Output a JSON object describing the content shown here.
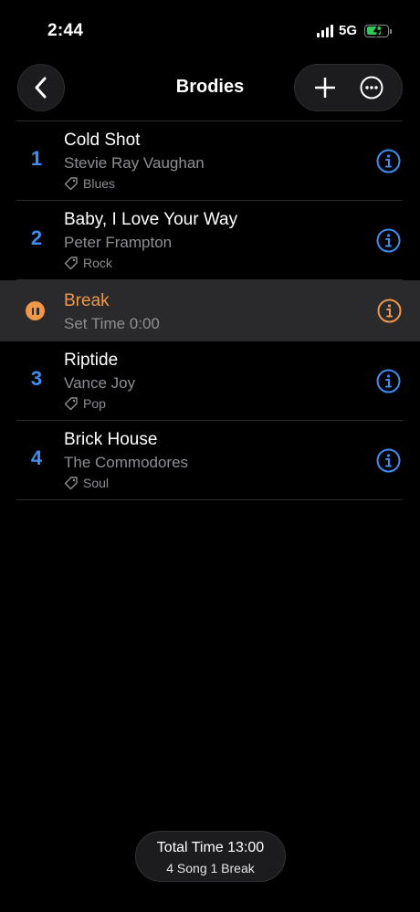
{
  "status_bar": {
    "time": "2:44",
    "network": "5G"
  },
  "nav": {
    "title": "Brodies",
    "back_icon": "chevron-left-icon",
    "add_icon": "plus-icon",
    "more_icon": "ellipsis-circle-icon"
  },
  "items": [
    {
      "type": "song",
      "number": "1",
      "title": "Cold Shot",
      "artist": "Stevie Ray Vaughan",
      "tag": "Blues"
    },
    {
      "type": "song",
      "number": "2",
      "title": "Baby, I Love Your Way",
      "artist": "Peter Frampton",
      "tag": "Rock"
    },
    {
      "type": "break",
      "title": "Break",
      "subtitle": "Set Time 0:00"
    },
    {
      "type": "song",
      "number": "3",
      "title": "Riptide",
      "artist": "Vance Joy",
      "tag": "Pop"
    },
    {
      "type": "song",
      "number": "4",
      "title": "Brick House",
      "artist": "The Commodores",
      "tag": "Soul"
    }
  ],
  "footer": {
    "total_time": "Total Time 13:00",
    "counts": "4 Song 1 Break"
  },
  "colors": {
    "accent_blue": "#3e8df3",
    "break_orange": "#f0974a",
    "battery_green": "#34c759"
  }
}
